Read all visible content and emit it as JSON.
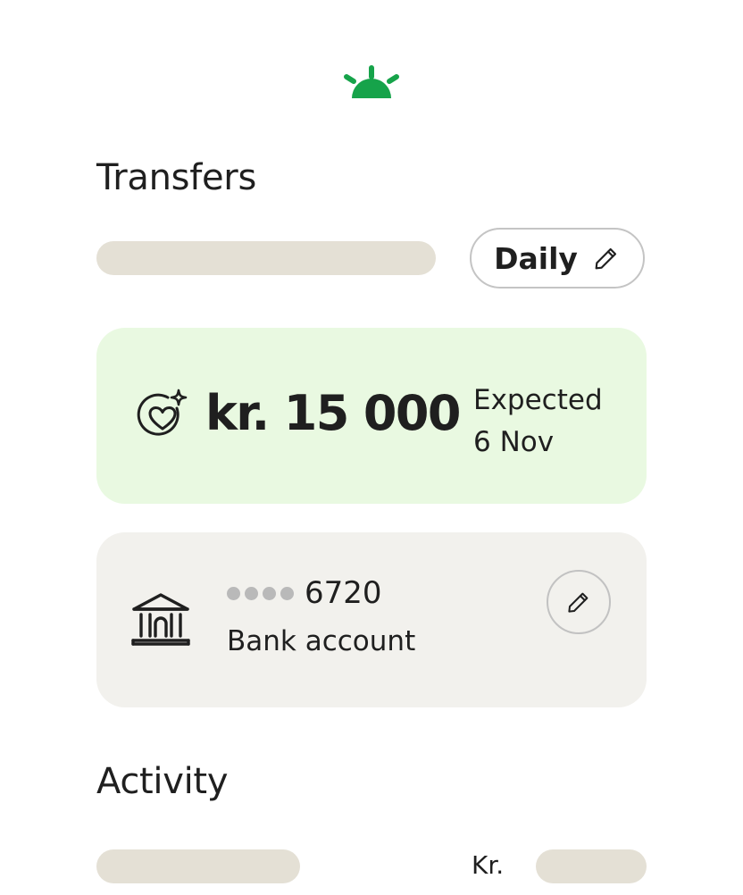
{
  "brand": {
    "logo_icon": "sunrise-logo-icon",
    "accent_color": "#16a34a"
  },
  "transfers": {
    "title": "Transfers",
    "frequency": {
      "label": "Daily",
      "icon": "pencil-icon"
    },
    "amount_card": {
      "icon": "heart-sparkle-icon",
      "amount": "kr. 15 000",
      "expected_label": "Expected",
      "expected_date": "6 Nov",
      "background_color": "#e9f9e1"
    },
    "bank_card": {
      "icon": "bank-icon",
      "masked_prefix_dots": 4,
      "account_number": "6720",
      "account_type": "Bank account",
      "edit_icon": "pencil-icon"
    }
  },
  "activity": {
    "title": "Activity",
    "currency_label": "Kr."
  }
}
